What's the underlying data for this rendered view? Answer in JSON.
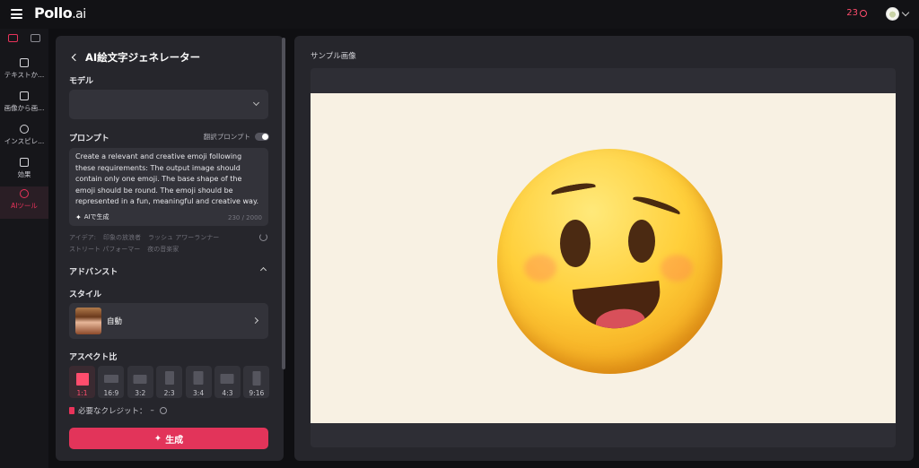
{
  "header": {
    "logo": "Pollo",
    "logo_suffix": ".ai",
    "credits": "23"
  },
  "sidenav": {
    "items": [
      {
        "label": "テキストか..."
      },
      {
        "label": "画像から画..."
      },
      {
        "label": "インスピレ..."
      },
      {
        "label": "効果"
      },
      {
        "label": "AIツール"
      }
    ]
  },
  "panel": {
    "title": "AI絵文字ジェネレーター",
    "model_label": "モデル",
    "model_value": "",
    "prompt_label": "プロンプト",
    "translate_label": "翻訳プロンプト",
    "prompt_text": "Create a relevant and creative emoji following these requirements: The output image should contain only one emoji. The base shape of the emoji should be round. The emoji should be represented in a fun, meaningful and creative way.",
    "ai_generate_label": "AIで生成",
    "char_count": "230 / 2000",
    "ideas": [
      "アイデア:",
      "印象の放浪者",
      "ラッシュ アワーランナー",
      "ストリート パフォーマー",
      "夜の音楽家"
    ],
    "advanced_label": "アドバンスト",
    "style_label": "スタイル",
    "style_value": "自動",
    "aspect_label": "アスペクト比",
    "aspect_ratios": [
      "1:1",
      "16:9",
      "3:2",
      "2:3",
      "3:4",
      "4:3",
      "9:16"
    ],
    "selected_ratio": "1:1",
    "credits_needed": "必要なクレジット：",
    "credits_needed_value": "–",
    "generate_label": "生成"
  },
  "preview": {
    "label": "サンプル画像"
  },
  "colors": {
    "accent": "#e2345a",
    "background": "#0f0f12",
    "panel": "#26262c"
  },
  "icons": [
    "menu-icon",
    "coin-icon",
    "chevron-down-icon",
    "back-icon",
    "sparkle-icon",
    "refresh-icon",
    "chevron-up-icon",
    "chevron-right-icon",
    "trash-icon",
    "info-icon"
  ]
}
